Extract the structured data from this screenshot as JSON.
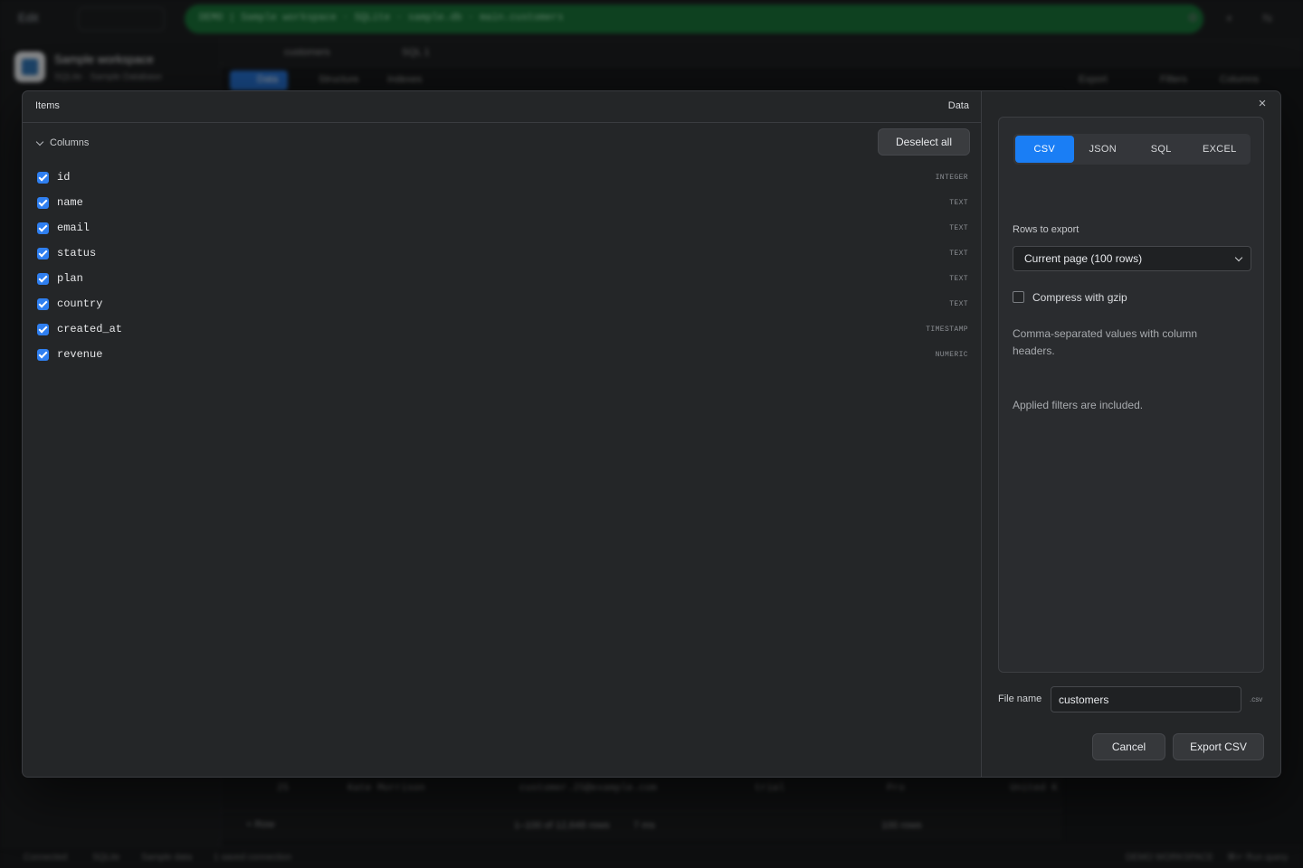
{
  "background": {
    "edit_label": "Edit",
    "address": "DEMO | Sample workspace · SQLite · sample.db · main.customers",
    "workspace_name": "Sample workspace",
    "workspace_sub": "SQLite · Sample Database",
    "tabs": [
      "customers",
      "SQL 1"
    ],
    "data_tab": "Data",
    "structure_tab": "Structure",
    "indexes_tab": "Indexes",
    "toolbar": [
      "Export",
      "Filters",
      "Columns"
    ],
    "row": {
      "id": "25",
      "name": "Kate Morrison",
      "email": "customer.25@example.com",
      "status": "trial",
      "plan": "Pro",
      "country": "United K"
    },
    "add_row": "+ Row",
    "pager_info": "1–100 of 12,648 rows",
    "pager_time": "7 ms",
    "page_size": "100 rows",
    "status_items": [
      "Connected",
      "SQLite",
      "Sample data",
      "1 saved connection"
    ],
    "status_right": [
      "DEMO WORKSPACE",
      "⌘↵ Run query"
    ]
  },
  "modal": {
    "close_glyph": "×",
    "items_header": "Items",
    "data_header": "Data",
    "group_label": "Columns",
    "deselect_label": "Deselect all",
    "columns": [
      {
        "name": "id",
        "type": "INTEGER",
        "checked": true
      },
      {
        "name": "name",
        "type": "TEXT",
        "checked": true
      },
      {
        "name": "email",
        "type": "TEXT",
        "checked": true
      },
      {
        "name": "status",
        "type": "TEXT",
        "checked": true
      },
      {
        "name": "plan",
        "type": "TEXT",
        "checked": true
      },
      {
        "name": "country",
        "type": "TEXT",
        "checked": true
      },
      {
        "name": "created_at",
        "type": "TIMESTAMP",
        "checked": true
      },
      {
        "name": "revenue",
        "type": "NUMERIC",
        "checked": true
      }
    ],
    "formats": [
      "CSV",
      "JSON",
      "SQL",
      "EXCEL"
    ],
    "active_format": "CSV",
    "rows_label": "Rows to export",
    "rows_value": "Current page (100 rows)",
    "gzip_label": "Compress with gzip",
    "gzip_checked": false,
    "description": "Comma-separated values with column headers.",
    "filters_note": "Applied filters are included.",
    "filename_label": "File name",
    "filename_value": "customers",
    "filename_ext": ".csv",
    "cancel_label": "Cancel",
    "export_label": "Export CSV"
  },
  "colors": {
    "accent": "#1a7ef5",
    "address_bar": "#0f6b2e",
    "modal_bg": "#242628"
  }
}
